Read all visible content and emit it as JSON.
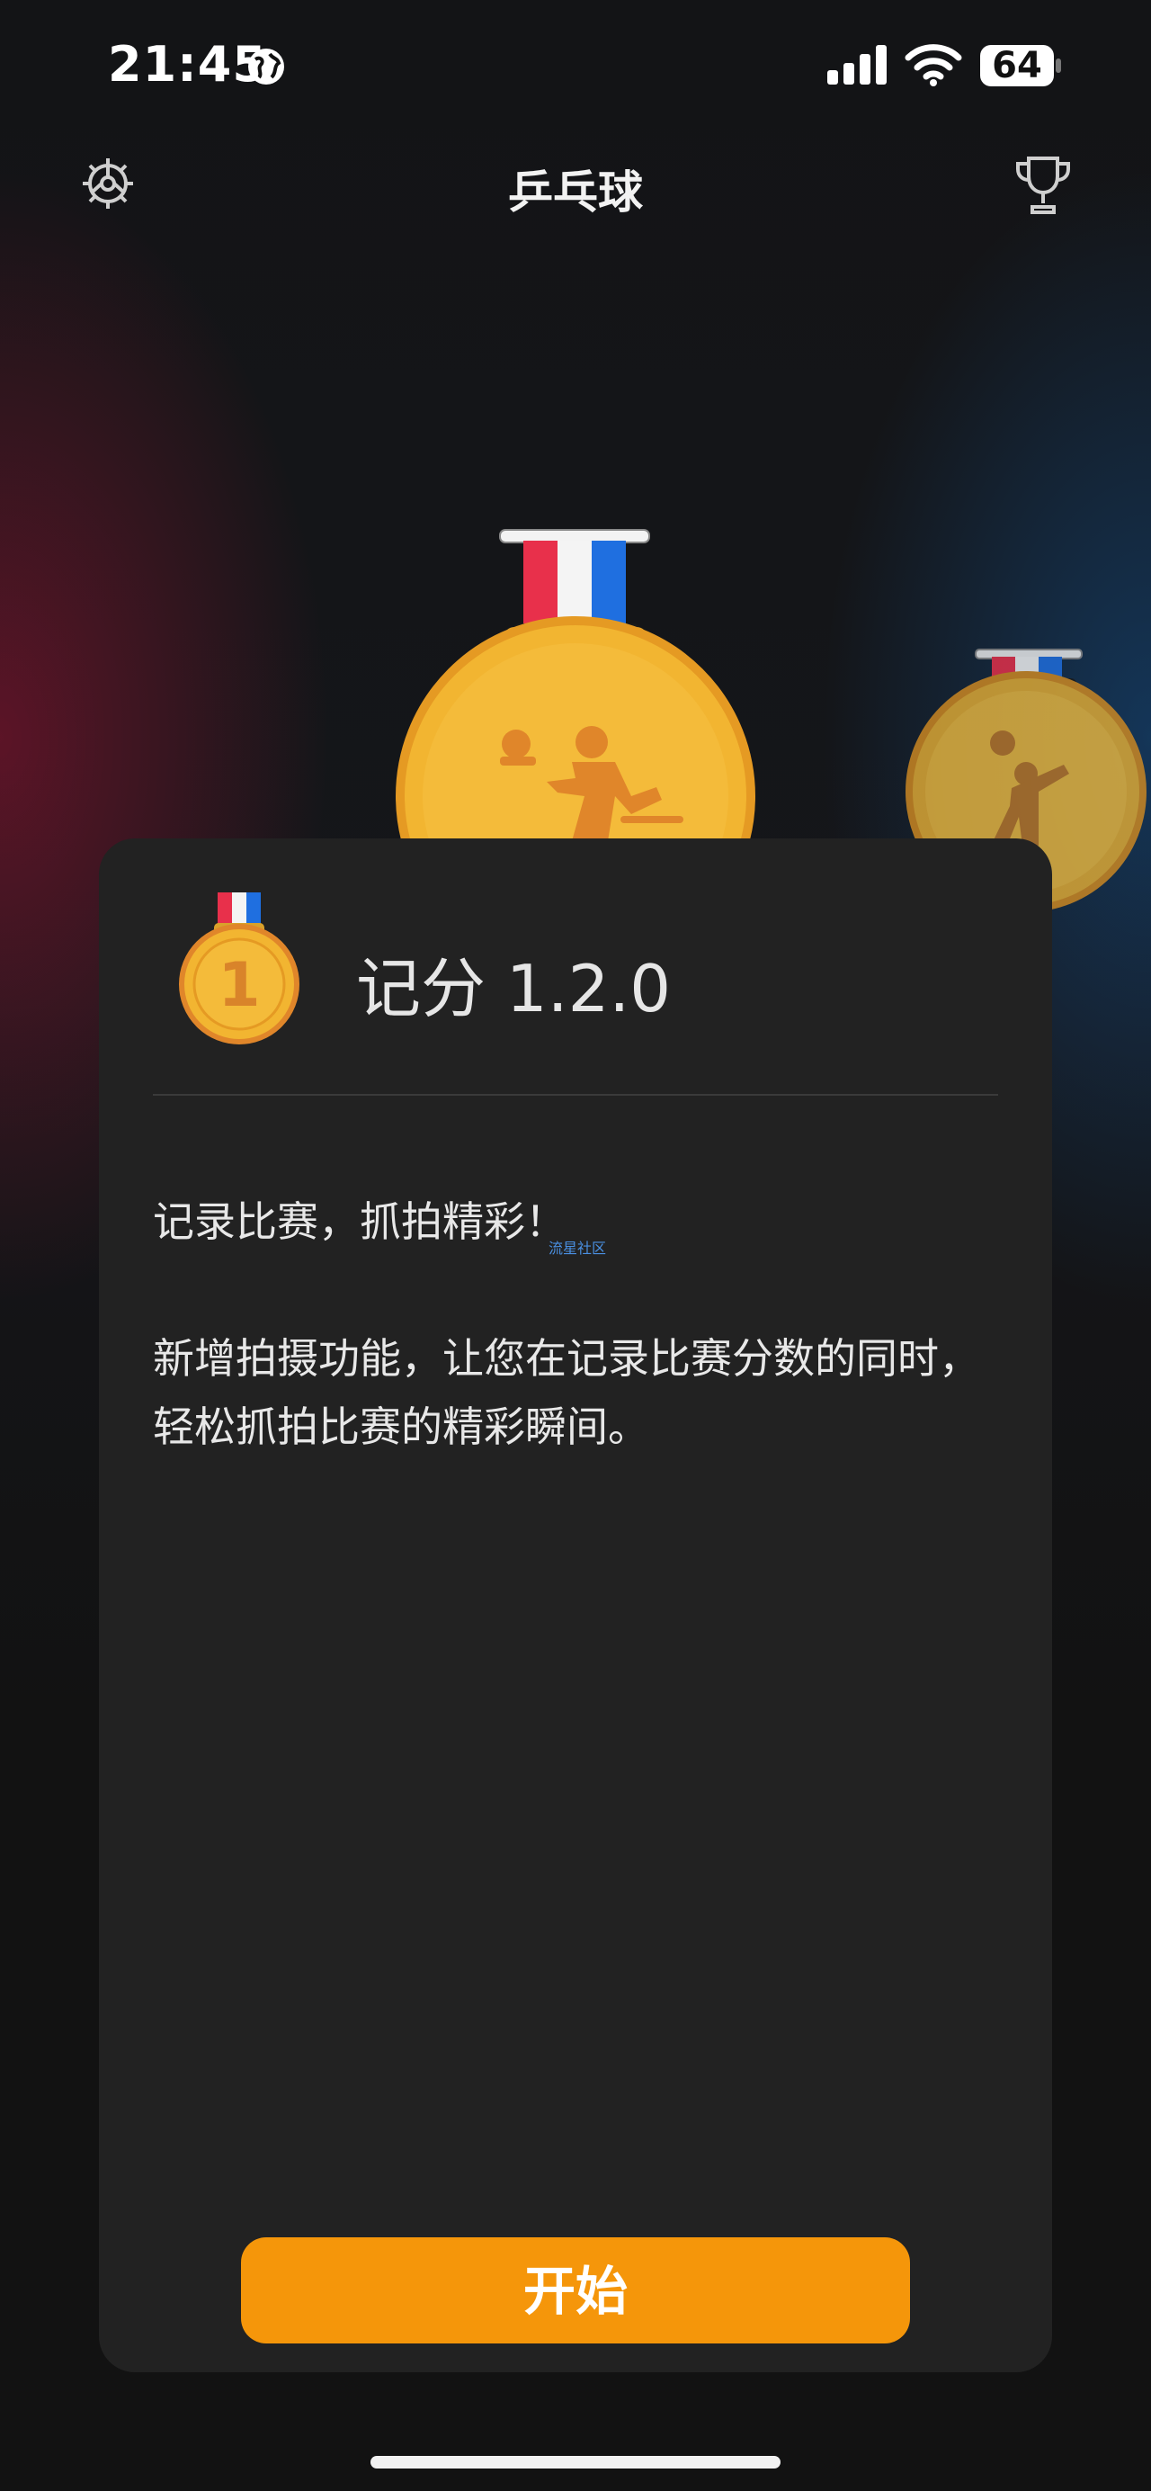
{
  "status_bar": {
    "time": "21:45",
    "battery": "64"
  },
  "nav": {
    "title": "乒乓球"
  },
  "card": {
    "title": "记分 1.2.0",
    "subtitle": "记录比赛，抓拍精彩！",
    "watermark": "流星社区",
    "description": "新增拍摄功能，让您在记录比赛分数的同时，轻松抓拍比赛的精彩瞬间。",
    "badge_number": "1",
    "start_label": "开始"
  },
  "colors": {
    "accent": "#f5960a",
    "card_bg": "#222222",
    "medal_gold": "#f2b531"
  }
}
